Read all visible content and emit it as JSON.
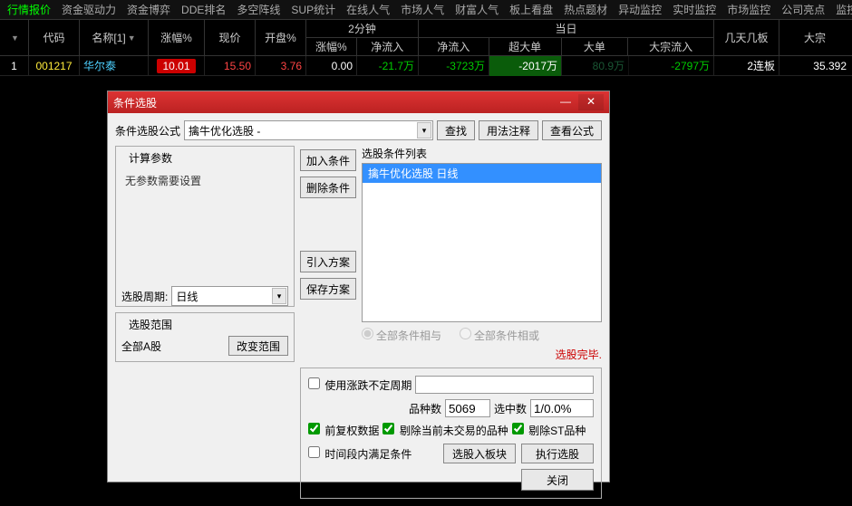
{
  "tabs": [
    "行情报价",
    "资金驱动力",
    "资金博弈",
    "DDE排名",
    "多空阵线",
    "SUP统计",
    "在线人气",
    "市场人气",
    "财富人气",
    "板上看盘",
    "热点题材",
    "异动监控",
    "实时监控",
    "市场监控",
    "公司亮点",
    "监控"
  ],
  "header": {
    "code": "代码",
    "name": "名称[1]",
    "pct": "涨幅%",
    "price": "现价",
    "open_pct": "开盘%",
    "group2min": "2分钟",
    "group_day": "当日",
    "sub_pct": "涨幅%",
    "sub_netin": "净流入",
    "sub_netin2": "净流入",
    "sub_super": "超大单",
    "sub_big": "大单",
    "sub_bigflow": "大宗流入",
    "boards": "几天几板",
    "bigdeal": "大宗"
  },
  "row": {
    "idx": "1",
    "code": "001217",
    "name": "华尔泰",
    "pct": "10.01",
    "price": "15.50",
    "open_pct": "3.76",
    "m2_pct": "0.00",
    "m2_netin": "-21.7万",
    "d_netin": "-3723万",
    "d_super": "-2017万",
    "d_big": "80.9万",
    "d_bigflow": "-2797万",
    "boards": "2连板",
    "bigdeal": "35.392"
  },
  "dialog": {
    "title": "条件选股",
    "formula_label": "条件选股公式",
    "formula_value": "擒牛优化选股 -",
    "find": "查找",
    "usage": "用法注释",
    "view_formula": "查看公式",
    "params_title": "计算参数",
    "params_text": "无参数需要设置",
    "period_label": "选股周期:",
    "period_value": "日线",
    "range_title": "选股范围",
    "range_value": "全部A股",
    "change_range": "改变范围",
    "add_cond": "加入条件",
    "del_cond": "删除条件",
    "load_plan": "引入方案",
    "save_plan": "保存方案",
    "list_label": "选股条件列表",
    "list_item": "擒牛优化选股  日线",
    "radio_and": "全部条件相与",
    "radio_or": "全部条件相或",
    "status": "选股完毕.",
    "use_var_period": "使用涨跌不定周期",
    "count_label": "品种数",
    "count_value": "5069",
    "selected_label": "选中数",
    "selected_value": "1/0.0%",
    "fq_data": "前复权数据",
    "excl_notrade": "剔除当前未交易的品种",
    "excl_st": "剔除ST品种",
    "time_range": "时间段内满足条件",
    "to_block": "选股入板块",
    "exec": "执行选股",
    "close": "关闭"
  }
}
